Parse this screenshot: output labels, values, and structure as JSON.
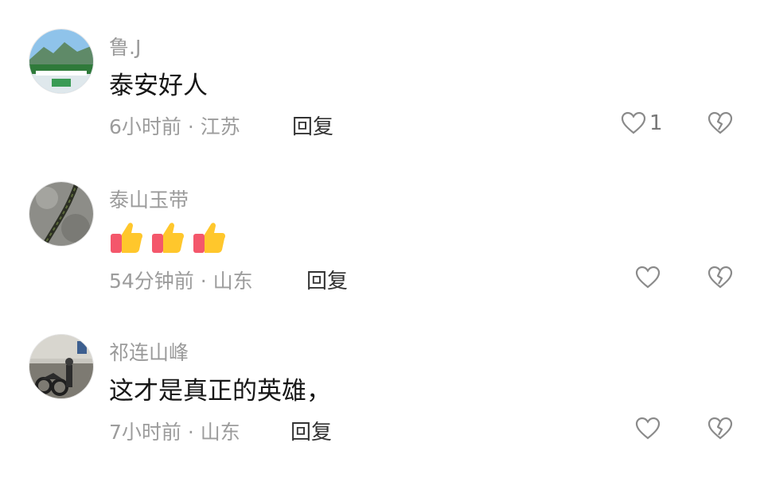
{
  "comments": [
    {
      "author": "鲁.J",
      "text": "泰安好人",
      "time": "6小时前",
      "location": "江苏",
      "meta": "6小时前 · 江苏",
      "reply_label": "回复",
      "likes": "1",
      "avatar_icon": "landscape-avatar"
    },
    {
      "author": "泰山玉带",
      "text": "",
      "emojis": [
        "thumbs-up-emoji",
        "thumbs-up-emoji",
        "thumbs-up-emoji"
      ],
      "time": "54分钟前",
      "location": "山东",
      "meta": "54分钟前 · 山东",
      "reply_label": "回复",
      "likes": "",
      "avatar_icon": "rope-avatar"
    },
    {
      "author": "祁连山峰",
      "text": "这才是真正的英雄，",
      "time": "7小时前",
      "location": "山东",
      "meta": "7小时前 · 山东",
      "reply_label": "回复",
      "likes": "",
      "avatar_icon": "motorcycle-avatar"
    }
  ],
  "icons": {
    "like": "heart-outline-icon",
    "dislike": "broken-heart-icon"
  },
  "colors": {
    "author": "#9a9a9a",
    "meta": "#9c9c9c",
    "text": "#161616",
    "icon": "#8a8a8a"
  }
}
